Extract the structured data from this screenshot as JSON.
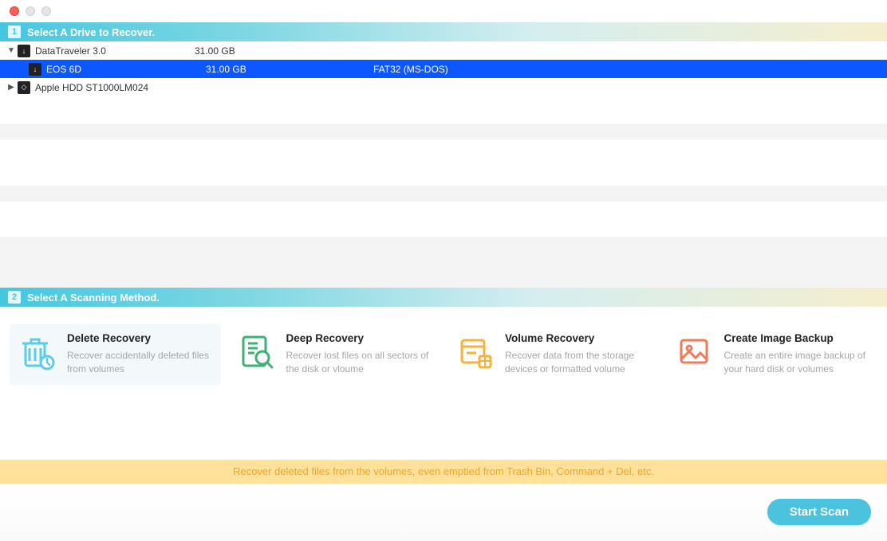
{
  "section1": {
    "num": "1",
    "title": "Select A Drive to Recover."
  },
  "drives": [
    {
      "expander": "▼",
      "icon": "↓",
      "name": "DataTraveler 3.0",
      "size": "31.00 GB",
      "fs": "",
      "depth": 0,
      "selected": false
    },
    {
      "expander": "",
      "icon": "↓",
      "name": "EOS 6D",
      "size": "31.00 GB",
      "fs": "FAT32 (MS-DOS)",
      "depth": 1,
      "selected": true
    },
    {
      "expander": "▶",
      "icon": "◇",
      "name": "Apple HDD ST1000LM024",
      "size": "",
      "fs": "",
      "depth": 0,
      "selected": false
    }
  ],
  "section2": {
    "num": "2",
    "title": "Select A Scanning Method."
  },
  "methods": [
    {
      "key": "delete",
      "title": "Delete Recovery",
      "desc": "Recover accidentally deleted files from volumes",
      "selected": true,
      "color": "#5bcde8"
    },
    {
      "key": "deep",
      "title": "Deep Recovery",
      "desc": "Recover lost files on all sectors of the disk or vloume",
      "selected": false,
      "color": "#3bb273"
    },
    {
      "key": "volume",
      "title": "Volume Recovery",
      "desc": "Recover data from the storage devices or formatted volume",
      "selected": false,
      "color": "#f4b13e"
    },
    {
      "key": "image",
      "title": "Create Image Backup",
      "desc": "Create an entire image backup of your hard disk or volumes",
      "selected": false,
      "color": "#f2795a"
    }
  ],
  "hint": "Recover deleted files from the volumes, even emptied from Trash Bin, Command + Del, etc.",
  "start_label": "Start Scan"
}
